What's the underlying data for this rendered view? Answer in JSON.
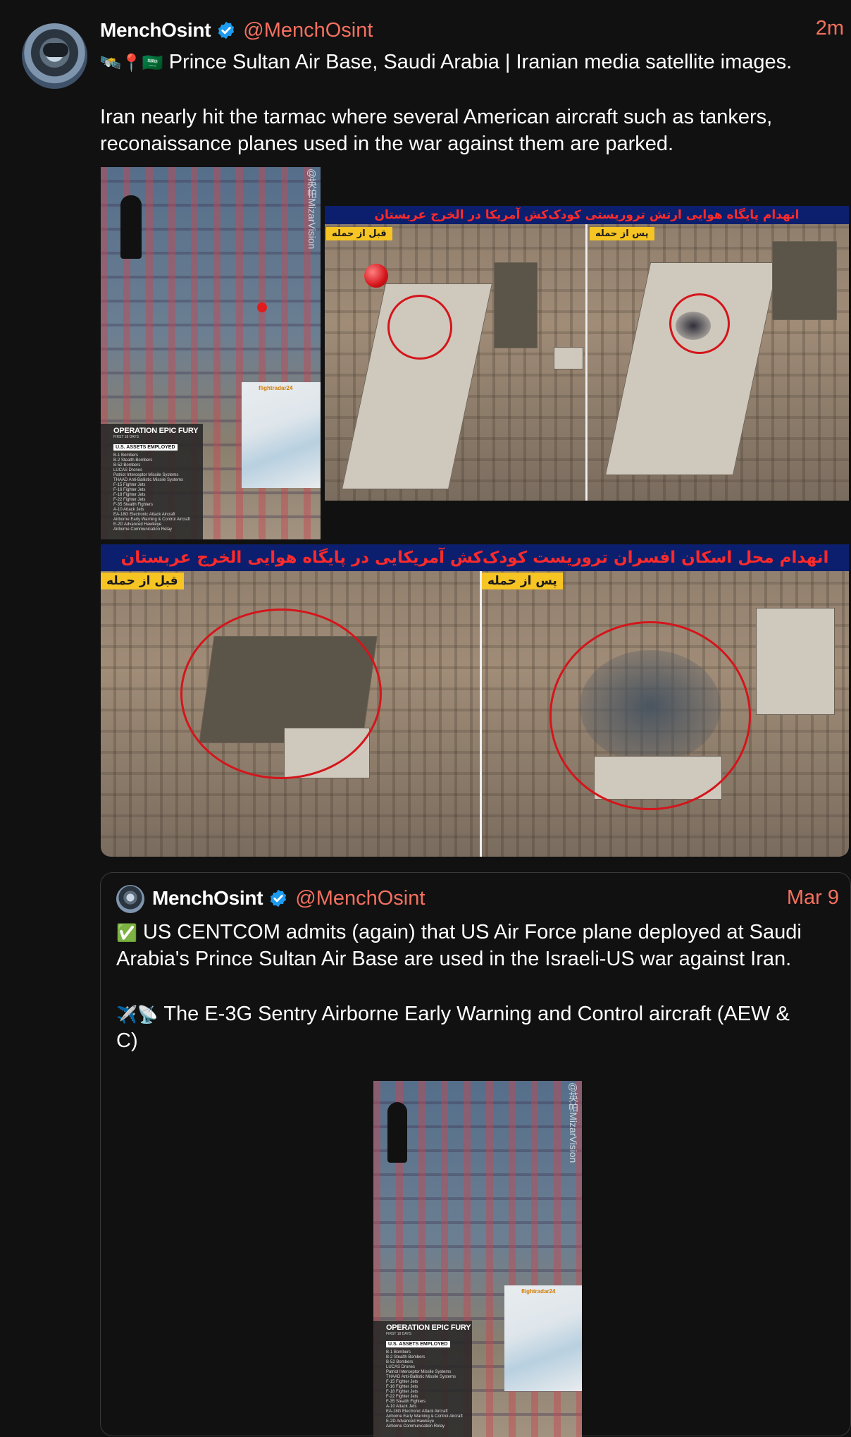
{
  "tweet": {
    "author_name": "MenchOsint",
    "handle": "@MenchOsint",
    "time": "2m",
    "line1_emoji": "🛰️📍🇸🇦",
    "line1": "Prince Sultan Air Base, Saudi Arabia | Iranian media satellite images.",
    "line2": "Iran nearly hit the tarmac where several American aircraft such as tankers,",
    "line3": "reconaissance planes used in the war against them are parked."
  },
  "media": {
    "collage": {
      "watermark": "@英帕MizarVision",
      "panel_title": "OPERATION EPIC FURY",
      "panel_subtitle": "FIRST 18 DAYS",
      "panel_box": "U.S. ASSETS EMPLOYED",
      "panel_lines": [
        "B-1 Bombers",
        "B-2 Stealth Bombers",
        "B-52 Bombers",
        "LUCAS Drones",
        "Patriot Interceptor Missile Systems",
        "THAAD Anti-Ballistic Missile Systems",
        "F-15 Fighter Jets",
        "F-16 Fighter Jets",
        "F-18 Fighter Jets",
        "F-22 Fighter Jets",
        "F-35 Stealth Fighters",
        "A-10 Attack Jets",
        "EA-18G Electronic Attack Aircraft",
        "Airborne Early Warning & Control Aircraft",
        "E-2D Advanced Hawkeye",
        "Airborne Communication Relay"
      ],
      "map_label": "flightradar24"
    },
    "hangar": {
      "banner": "انهدام پایگاه هوایی ارتش تروریستی کودک‌کش آمریکا در الخرج عربستان",
      "before": "قبل از حمله",
      "after": "پس از حمله"
    },
    "quarters": {
      "banner": "انهدام محل اسکان افسران تروریست کودک‌کش آمریکایی در پایگاه هوایی الخرج عربستان",
      "before": "قبل از حمله",
      "after": "پس از حمله"
    }
  },
  "quoted": {
    "author_name": "MenchOsint",
    "handle": "@MenchOsint",
    "time": "Mar 9",
    "line1_emoji": "✅",
    "line1": "US CENTCOM admits (again) that US Air Force plane deployed at Saudi",
    "line2": "Arabia's Prince Sultan Air Base are used in the Israeli-US war against Iran.",
    "line3_emoji": "✈️📡",
    "line3": "The E-3G Sentry Airborne Early Warning and Control aircraft (AEW &",
    "line4": "C)"
  },
  "colors": {
    "accent": "#f4705f",
    "verified": "#1d9bf0",
    "background": "#111111"
  }
}
